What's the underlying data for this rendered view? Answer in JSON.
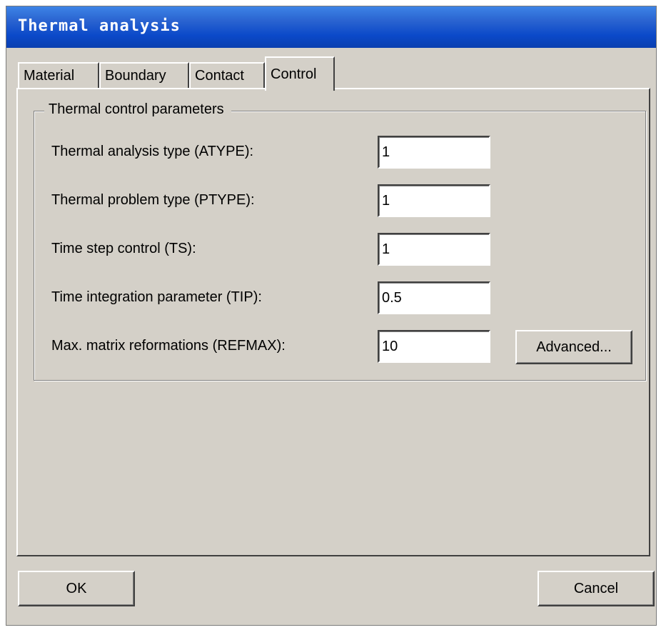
{
  "window": {
    "title": "Thermal analysis"
  },
  "tabs": [
    {
      "label": "Material",
      "active": false
    },
    {
      "label": "Boundary",
      "active": false
    },
    {
      "label": "Contact",
      "active": false
    },
    {
      "label": "Control",
      "active": true
    }
  ],
  "control": {
    "group_label": "Thermal control parameters",
    "params": [
      {
        "label": "Thermal analysis type (ATYPE):",
        "value": "1"
      },
      {
        "label": "Thermal problem type (PTYPE):",
        "value": "1"
      },
      {
        "label": "Time step control (TS):",
        "value": "1"
      },
      {
        "label": "Time integration parameter (TIP):",
        "value": "0.5"
      },
      {
        "label": "Max. matrix reformations (REFMAX):",
        "value": "10"
      }
    ],
    "advanced_label": "Advanced..."
  },
  "footer": {
    "ok_label": "OK",
    "cancel_label": "Cancel"
  },
  "colors": {
    "titlebar": "#0b49c9",
    "dialog_bg": "#d4d0c8",
    "input_bg": "#ffffff"
  }
}
